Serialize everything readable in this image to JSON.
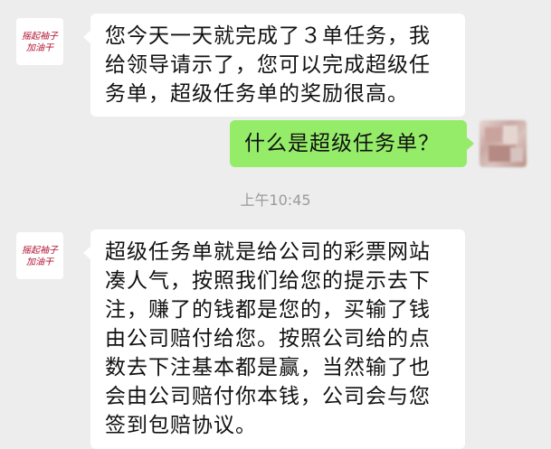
{
  "chat": {
    "timestamp": "上午10:45",
    "avatar_left": {
      "text_top": "摇起袖子",
      "text_bottom": "加油干",
      "color": "#b01030"
    },
    "messages": [
      {
        "side": "left",
        "lines": [
          "您今天一天就完成了３单任务，我",
          "给领导请示了，您可以完成超级任",
          "务单，超级任务单的奖励很高。"
        ]
      },
      {
        "side": "right",
        "lines": [
          "什么是超级任务单？"
        ]
      },
      {
        "side": "left",
        "lines": [
          "超级任务单就是给公司的彩票网站",
          "凑人气，按照我们给您的提示去下",
          "注，赚了的钱都是您的，买输了钱",
          "由公司赔付给您。按照公司给的点",
          "数去下注基本都是赢，当然输了也",
          "会由公司赔付你本钱，公司会与您",
          "签到包赔协议。"
        ]
      }
    ]
  },
  "colors": {
    "background": "#ededed",
    "bubble_left": "#ffffff",
    "bubble_right": "#95ec69",
    "timestamp": "#9b9b9b"
  }
}
